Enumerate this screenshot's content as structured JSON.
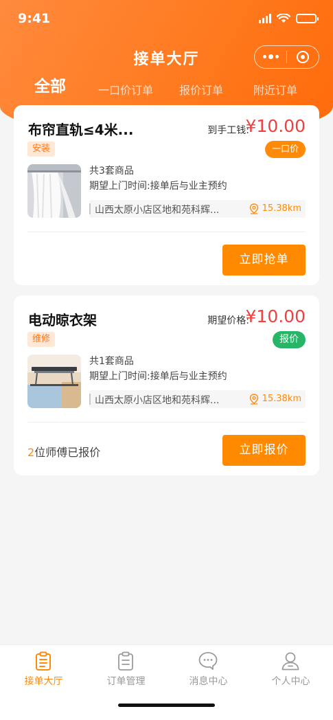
{
  "status": {
    "time": "9:41"
  },
  "nav": {
    "title": "接单大厅"
  },
  "tabs": [
    {
      "label": "全部",
      "active": true
    },
    {
      "label": "一口价订单",
      "active": false
    },
    {
      "label": "报价订单",
      "active": false
    },
    {
      "label": "附近订单",
      "active": false
    }
  ],
  "orders": [
    {
      "title": "布帘直轨≤4米...",
      "price_label": "到手工钱:",
      "price": "¥10.00",
      "tag": "安装",
      "badge": "一口价",
      "badge_color": "#ff8a0a",
      "thumbnail": "curtain-image",
      "count": "共3套商品",
      "time": "期望上门时间:接单后与业主预约",
      "address": "山西太原小店区地和苑科辉...",
      "distance": "15.38km",
      "action": "立即抢单"
    },
    {
      "title": "电动晾衣架",
      "price_label": "期望价格:",
      "price": "¥10.00",
      "tag": "维修",
      "badge": "报价",
      "badge_color": "#27b667",
      "thumbnail": "drying-rack-image",
      "count": "共1套商品",
      "time": "期望上门时间:接单后与业主预约",
      "address": "山西太原小店区地和苑科辉...",
      "distance": "15.38km",
      "quoted_num": "2",
      "quoted_text": "位师傅已报价",
      "action": "立即报价"
    }
  ],
  "tabbar": [
    {
      "label": "接单大厅",
      "icon": "clipboard-list-icon",
      "active": true
    },
    {
      "label": "订单管理",
      "icon": "clipboard-icon",
      "active": false
    },
    {
      "label": "消息中心",
      "icon": "chat-bubble-icon",
      "active": false
    },
    {
      "label": "个人中心",
      "icon": "user-icon",
      "active": false
    }
  ],
  "colors": {
    "accent": "#ff8a00",
    "price": "#f04040",
    "green": "#27b667",
    "header": "#ff7a1f"
  }
}
